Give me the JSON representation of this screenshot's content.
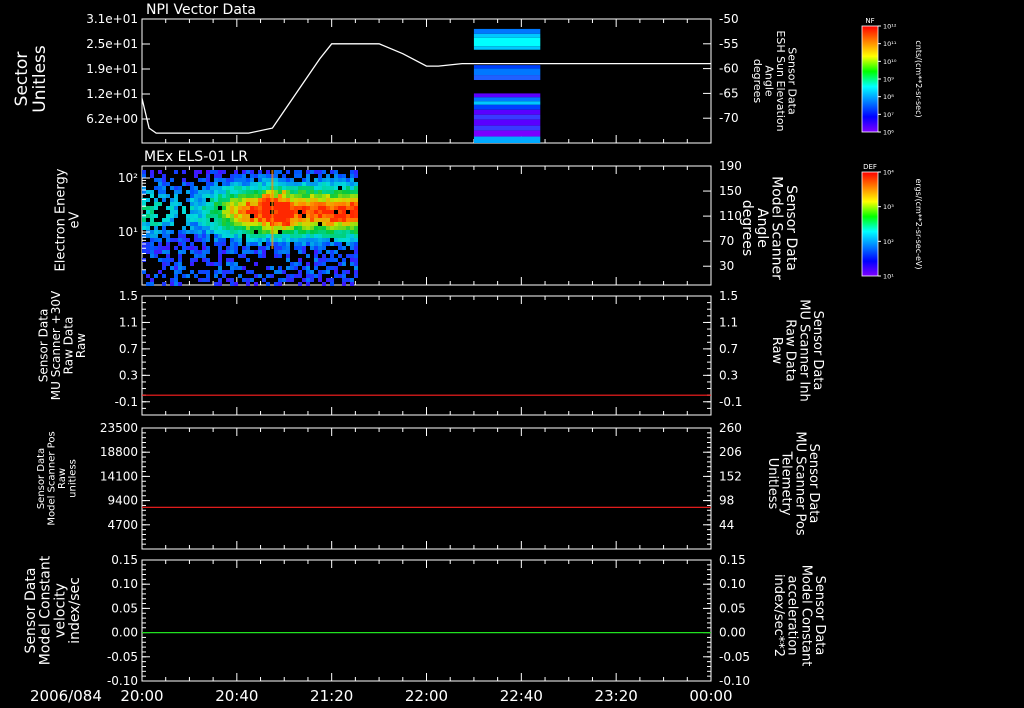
{
  "date_label": "2006/084",
  "time_ticks": [
    "20:00",
    "20:40",
    "21:20",
    "22:00",
    "22:40",
    "23:20",
    "00:00"
  ],
  "colors": {
    "background": "#000000",
    "axis": "#ffffff",
    "line_white": "#ffffff",
    "line_red": "#ff2020",
    "line_green": "#20e020",
    "label_red": "#ff2020",
    "label_green": "#20e020"
  },
  "colorbars": [
    {
      "title": "NF",
      "ticks": [
        "10¹²",
        "10¹¹",
        "10¹⁰",
        "10⁹",
        "10⁸",
        "10⁷",
        "10⁶"
      ],
      "unit": "cnts/(cm**2-sr-sec)"
    },
    {
      "title": "DEF",
      "ticks": [
        "10⁴",
        "10³",
        "10²",
        "10¹"
      ],
      "unit": "ergs/(cm**2-sr-sec-eV)"
    }
  ],
  "chart_data": [
    {
      "type": "line",
      "title": "NPI Vector Data",
      "ylabel_left": [
        "Sector",
        "Unitless"
      ],
      "yticks_left": [
        "3.1e+01",
        "2.5e+01",
        "1.9e+01",
        "1.2e+01",
        "6.2e+00"
      ],
      "ylabel_right": [
        "Sensor Data",
        "ESH Sun Elevation",
        "Angle",
        "degrees"
      ],
      "yticks_right": [
        "-50",
        "-55",
        "-60",
        "-65",
        "-70"
      ],
      "ylim_right": [
        -75,
        -50
      ],
      "x": [
        "20:00",
        "20:03",
        "20:06",
        "20:30",
        "20:45",
        "20:55",
        "21:05",
        "21:15",
        "21:20",
        "21:30",
        "21:40",
        "21:50",
        "22:00",
        "22:05",
        "22:15",
        "22:30",
        "23:00",
        "23:30",
        "00:00"
      ],
      "series": [
        {
          "values": [
            -66,
            -72,
            -73,
            -73,
            -73,
            -72,
            -65,
            -58,
            -55,
            -55,
            -55,
            -57,
            -59.5,
            -59.5,
            -59,
            -59,
            -59,
            -59,
            -59
          ]
        }
      ],
      "spectrogram": {
        "x_range": [
          "22:20",
          "22:48"
        ],
        "bands": [
          {
            "y": [
              -53,
              -52
            ],
            "color": "#0078ff"
          },
          {
            "y": [
              -53.8,
              -53
            ],
            "color": "#00c8ff"
          },
          {
            "y": [
              -55.5,
              -53.8
            ],
            "color": "#00ffff"
          },
          {
            "y": [
              -56.2,
              -55.5
            ],
            "color": "#00c8ff"
          },
          {
            "y": [
              -60,
              -59.3
            ],
            "color": "#0040ff"
          },
          {
            "y": [
              -61.3,
              -60
            ],
            "color": "#0078ff"
          },
          {
            "y": [
              -62.3,
              -61.3
            ],
            "color": "#2060ff"
          },
          {
            "y": [
              -65.8,
              -65
            ],
            "color": "#5a00ff"
          },
          {
            "y": [
              -66.6,
              -65.8
            ],
            "color": "#0078ff"
          },
          {
            "y": [
              -67.3,
              -66.6
            ],
            "color": "#00c8ff"
          },
          {
            "y": [
              -68.3,
              -67.3
            ],
            "color": "#0040ff"
          },
          {
            "y": [
              -69.3,
              -68.3
            ],
            "color": "#5a00ff"
          },
          {
            "y": [
              -70.3,
              -69.3
            ],
            "color": "#3a3aff"
          },
          {
            "y": [
              -71.5,
              -70.3
            ],
            "color": "#5a00ff"
          },
          {
            "y": [
              -72.5,
              -71.5
            ],
            "color": "#3a3aff"
          },
          {
            "y": [
              -73.7,
              -72.5
            ],
            "color": "#7a00ff"
          },
          {
            "y": [
              -75,
              -73.7
            ],
            "color": "#00aaff"
          }
        ]
      }
    },
    {
      "type": "heatmap",
      "title": "MEx ELS-01 LR",
      "ylabel_left": [
        "Electron Energy",
        "eV"
      ],
      "yticks_left": [
        "10²",
        "10¹"
      ],
      "ylabel_right": [
        "Sensor Data",
        "Model Scanner",
        "Angle",
        "degrees"
      ],
      "yticks_right": [
        "190",
        "150",
        "110",
        "70",
        "30"
      ],
      "ylim_right": [
        0,
        190
      ],
      "x_range": [
        "20:00",
        "21:30"
      ],
      "energy_range_log10": [
        0.4,
        2.3
      ]
    },
    {
      "type": "line",
      "ylabel_left": [
        "Sensor Data",
        "MU Scanner +30V",
        "Raw Data",
        "Raw"
      ],
      "yticks_left": [
        "1.5",
        "1.1",
        "0.7",
        "0.3",
        "-0.1"
      ],
      "ylabel_right": [
        "Sensor Data",
        "MU Scanner Inh",
        "Raw Data",
        "Raw"
      ],
      "yticks_right": [
        "1.5",
        "1.1",
        "0.7",
        "0.3",
        "-0.1"
      ],
      "ylim": [
        -0.3,
        1.5
      ],
      "series": [
        {
          "values": [
            0,
            0
          ]
        }
      ],
      "x": [
        "20:00",
        "00:00"
      ]
    },
    {
      "type": "line",
      "ylabel_left": [
        "Sensor Data",
        "Model Scanner Pos",
        "Raw",
        "unitless"
      ],
      "yticks_left": [
        "23500",
        "18800",
        "14100",
        "9400",
        "4700"
      ],
      "ylabel_right": [
        "Sensor Data",
        "MU Scanner Pos",
        "Telemetry",
        "Unitless"
      ],
      "yticks_right": [
        "260",
        "206",
        "152",
        "98",
        "44"
      ],
      "ylim": [
        0,
        23500
      ],
      "series": [
        {
          "values": [
            8100,
            8100
          ]
        }
      ],
      "x": [
        "20:00",
        "00:00"
      ]
    },
    {
      "type": "line",
      "ylabel_left": [
        "Sensor Data",
        "Model Constant",
        "velocity",
        "index/sec"
      ],
      "yticks_left": [
        "0.15",
        "0.10",
        "0.05",
        "0.00",
        "-0.05",
        "-0.10"
      ],
      "ylabel_right": [
        "Sensor Data",
        "Model Constant",
        "acceleration",
        "index/sec**2"
      ],
      "yticks_right": [
        "0.15",
        "0.10",
        "0.05",
        "0.00",
        "-0.05",
        "-0.10"
      ],
      "ylim": [
        -0.1,
        0.15
      ],
      "series": [
        {
          "values": [
            0,
            0
          ]
        }
      ],
      "x": [
        "20:00",
        "00:00"
      ]
    }
  ]
}
